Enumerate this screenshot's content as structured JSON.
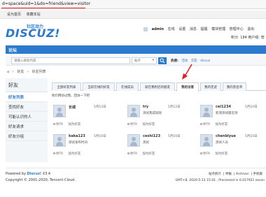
{
  "browser": {
    "url": "d=space&uid=1&do=friend&view=visitor"
  },
  "topstrip": {
    "links": [
      "设为首页",
      "收藏本站"
    ]
  },
  "logo": {
    "text": "DISCUZ!",
    "sub": "社区动力"
  },
  "userbar": {
    "username": "admin",
    "status": "在线",
    "items": [
      "设置",
      "消息",
      "提醒",
      "模块管理",
      "管理中心",
      "退出"
    ],
    "credits_label": "积分: 184",
    "group_label": "用户组: 管"
  },
  "nav": {
    "items": [
      "论坛"
    ]
  },
  "search": {
    "placeholder": "请输入搜索内容",
    "type": "帖子",
    "hot_label": "热搜:",
    "hot_terms": [
      "活动",
      "交友",
      "discuz"
    ]
  },
  "breadcrumb": [
    "好友",
    "›",
    "好友列表"
  ],
  "sidebar": {
    "title": "好友",
    "items": [
      {
        "label": "好友列表",
        "active": true
      },
      {
        "label": "查找好友",
        "active": false
      },
      {
        "label": "可能认识的人",
        "active": false
      },
      {
        "label": "好友请求",
        "active": false
      },
      {
        "label": "好友分组",
        "active": false
      }
    ]
  },
  "tabs": [
    {
      "label": "全部好友列表",
      "active": false
    },
    {
      "label": "当前在线的好友",
      "active": false
    },
    {
      "label": "在线成员",
      "active": false
    },
    {
      "label": "就在我附近的朋友",
      "active": false
    },
    {
      "label": "我的访客",
      "active": true
    },
    {
      "label": "我的足迹",
      "active": false
    },
    {
      "label": "我的黑名单",
      "active": false
    }
  ],
  "subtitle": "他们拜访过我，回访一下吧",
  "cards": [
    {
      "name": "长城",
      "date": "5月13日",
      "note": "",
      "actions": [
        "你TA",
        "加为好友"
      ]
    },
    {
      "name": "try",
      "date": "5月12日",
      "note": "测试我成就呢",
      "actions": [
        "你TA",
        "加为好友"
      ]
    },
    {
      "name": "cei1234",
      "date": "5月10日",
      "note": "新测测试最近测",
      "actions": [
        "你TA",
        "加为好友"
      ]
    },
    {
      "name": "kaka123",
      "date": "5月10日",
      "note": "测试发布时间",
      "actions": [
        "你TA",
        "加为好友"
      ]
    },
    {
      "name": "ceshi123",
      "date": "5月10日",
      "note": "测试",
      "actions": [
        "你TA",
        "加为好友"
      ]
    },
    {
      "name": "chenblyue",
      "date": "5月10日",
      "note": "测试人员",
      "actions": [
        "你TA",
        "加为好友"
      ]
    }
  ],
  "footer": {
    "powered_prefix": "Powered by",
    "product": "Discuz!",
    "version": "X3.4",
    "copyright": "Copyright © 2001-2020, Tencent Cloud.",
    "links": [
      "站点统计",
      "举报",
      "Archiver",
      "手机版"
    ],
    "gmt": "GMT+8, 2020-5-13 15:41 , Processed in 0.017921 secon"
  },
  "colors": {
    "brand": "#2b7acd",
    "annotation_red": "#e02020"
  }
}
